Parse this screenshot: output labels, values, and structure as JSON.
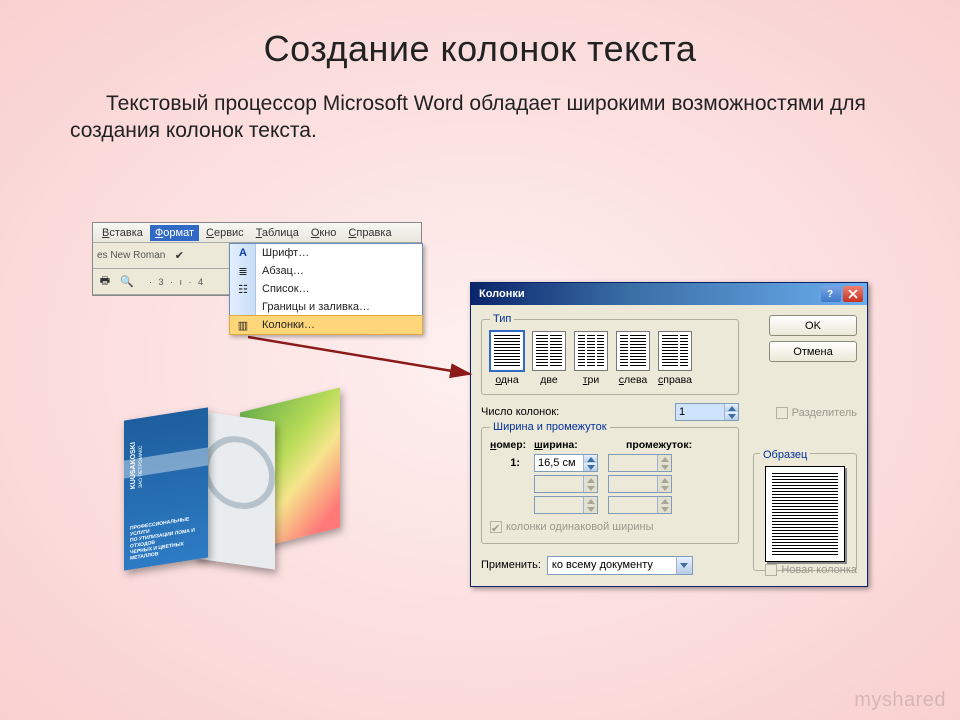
{
  "slide": {
    "title": "Создание колонок текста",
    "body": "Текстовый процессор Microsoft Word обладает широкими возможностями для создания колонок текста.",
    "watermark": "myshared"
  },
  "word_menu": {
    "menubar": [
      "Вставка",
      "Формат",
      "Сервис",
      "Таблица",
      "Окно",
      "Справка"
    ],
    "font_sample": "es New Roman",
    "ruler": "· 3 · ı · 4",
    "dropdown": [
      {
        "label": "Шрифт…"
      },
      {
        "label": "Абзац…"
      },
      {
        "label": "Список…"
      },
      {
        "label": "Границы и заливка…"
      },
      {
        "label": "Колонки…"
      }
    ]
  },
  "brochure": {
    "brand_top": "KUUSAKOSKI",
    "brand_sub": "ЗАО ПЕТРОМАКС",
    "small1": "ПРОФЕССИОНАЛЬНЫЕ УСЛУГИ",
    "small2": "ПО УТИЛИЗАЦИИ ЛОМА И ОТХОДОВ",
    "small3": "ЧЕРНЫХ И ЦВЕТНЫХ МЕТАЛЛОВ"
  },
  "dialog": {
    "title": "Колонки",
    "group_type": "Тип",
    "types": [
      {
        "key": "one",
        "label": "одна"
      },
      {
        "key": "two",
        "label": "две"
      },
      {
        "key": "three",
        "label": "три"
      },
      {
        "key": "left",
        "label": "слева"
      },
      {
        "key": "right",
        "label": "справа"
      }
    ],
    "ok": "OK",
    "cancel": "Отмена",
    "count_label": "Число колонок:",
    "count_value": "1",
    "separator_label": "Разделитель",
    "group_width": "Ширина и промежуток",
    "hdr_num": "номер:",
    "hdr_width": "ширина:",
    "hdr_gap": "промежуток:",
    "row1_num": "1:",
    "row1_width": "16,5 см",
    "equal_label": "колонки одинаковой ширины",
    "sample_label": "Образец",
    "apply_label": "Применить:",
    "apply_value": "ко всему документу",
    "newcol_label": "Новая колонка"
  }
}
